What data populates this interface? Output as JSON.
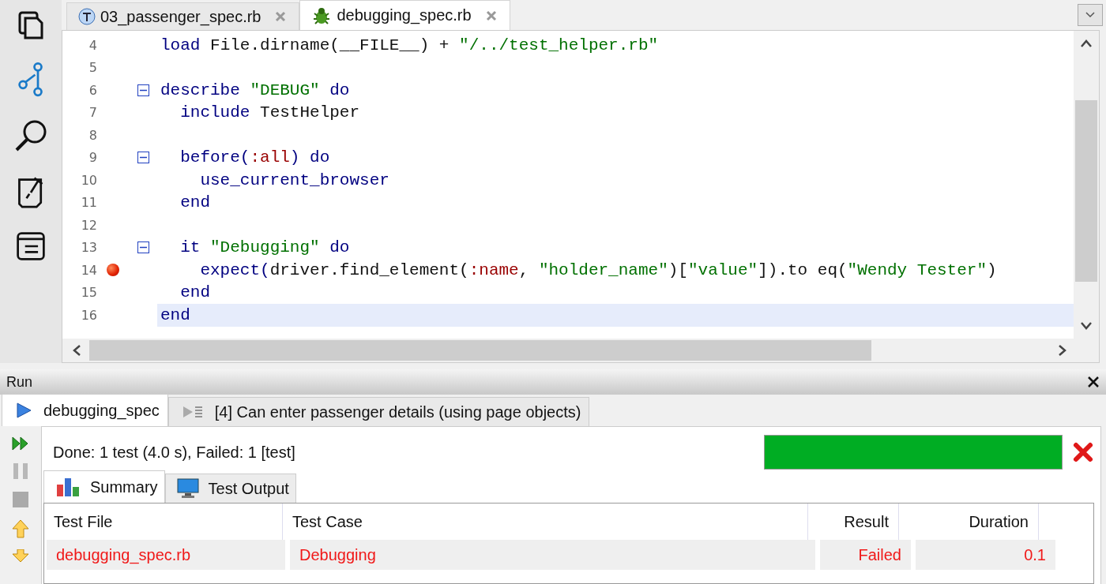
{
  "editor_tabs": [
    {
      "label": "03_passenger_spec.rb",
      "selected": false,
      "kind": "test"
    },
    {
      "label": "debugging_spec.rb",
      "selected": true,
      "kind": "debug"
    }
  ],
  "editor": {
    "lines": [
      {
        "number": "4",
        "fold": false,
        "breakpoint": false,
        "current": false,
        "tokens": [
          {
            "kind": "kw",
            "text": "load"
          },
          {
            "kind": "plain",
            "text": " File.dirname(__FILE__) + "
          },
          {
            "kind": "str",
            "text": "\"/../test_helper.rb\""
          }
        ]
      },
      {
        "number": "5",
        "fold": false,
        "breakpoint": false,
        "current": false
      },
      {
        "number": "6",
        "fold": true,
        "breakpoint": false,
        "current": false,
        "tokens": [
          {
            "kind": "kw",
            "text": "describe "
          },
          {
            "kind": "str",
            "text": "\"DEBUG\""
          },
          {
            "kind": "kw",
            "text": " do"
          }
        ]
      },
      {
        "number": "7",
        "fold": false,
        "breakpoint": false,
        "current": false,
        "tokens": [
          {
            "kind": "kw",
            "text": "  include"
          },
          {
            "kind": "plain",
            "text": " TestHelper"
          }
        ]
      },
      {
        "number": "8",
        "fold": false,
        "breakpoint": false,
        "current": false
      },
      {
        "number": "9",
        "fold": true,
        "breakpoint": false,
        "current": false,
        "tokens": [
          {
            "kind": "kw",
            "text": "  before("
          },
          {
            "kind": "sym",
            "text": ":all"
          },
          {
            "kind": "kw",
            "text": ") do"
          }
        ]
      },
      {
        "number": "10",
        "fold": false,
        "breakpoint": false,
        "current": false,
        "tokens": [
          {
            "kind": "kw",
            "text": "    use_current_browser"
          }
        ]
      },
      {
        "number": "11",
        "fold": false,
        "breakpoint": false,
        "current": false,
        "tokens": [
          {
            "kind": "kw",
            "text": "  end"
          }
        ]
      },
      {
        "number": "12",
        "fold": false,
        "breakpoint": false,
        "current": false
      },
      {
        "number": "13",
        "fold": true,
        "breakpoint": false,
        "current": false,
        "tokens": [
          {
            "kind": "kw",
            "text": "  it "
          },
          {
            "kind": "str",
            "text": "\"Debugging\""
          },
          {
            "kind": "kw",
            "text": " do"
          }
        ]
      },
      {
        "number": "14",
        "fold": false,
        "breakpoint": true,
        "current": false,
        "tokens": [
          {
            "kind": "kw",
            "text": "    expect("
          },
          {
            "kind": "plain",
            "text": "driver.find_element("
          },
          {
            "kind": "sym",
            "text": ":name"
          },
          {
            "kind": "plain",
            "text": ", "
          },
          {
            "kind": "str",
            "text": "\"holder_name\""
          },
          {
            "kind": "plain",
            "text": ")["
          },
          {
            "kind": "str",
            "text": "\"value\""
          },
          {
            "kind": "plain",
            "text": "]).to eq("
          },
          {
            "kind": "str",
            "text": "\"Wendy Tester\""
          },
          {
            "kind": "plain",
            "text": ")"
          }
        ]
      },
      {
        "number": "15",
        "fold": false,
        "breakpoint": false,
        "current": false,
        "tokens": [
          {
            "kind": "kw",
            "text": "  end"
          }
        ]
      },
      {
        "number": "16",
        "fold": false,
        "breakpoint": false,
        "current": true,
        "tokens": [
          {
            "kind": "kw",
            "text": "end"
          }
        ]
      }
    ]
  },
  "run_panel": {
    "title": "Run",
    "tabs": [
      {
        "label": "debugging_spec",
        "selected": true,
        "kind": "run"
      },
      {
        "label": "[4] Can enter passenger details (using page objects)",
        "selected": false,
        "kind": "list"
      }
    ],
    "status": "Done: 1 test (4.0 s), Failed: 1 [test]",
    "progress": {
      "level": 1
    },
    "result_tabs": [
      {
        "label": "Summary",
        "selected": true,
        "kind": "chart"
      },
      {
        "label": "Test Output",
        "selected": false,
        "kind": "monitor"
      }
    ],
    "table": {
      "columns": [
        "Test File",
        "Test Case",
        "Result",
        "Duration"
      ],
      "rows": [
        {
          "cells": [
            "debugging_spec.rb",
            "Debugging",
            "Failed",
            "0.1"
          ],
          "failed": true
        }
      ]
    }
  }
}
